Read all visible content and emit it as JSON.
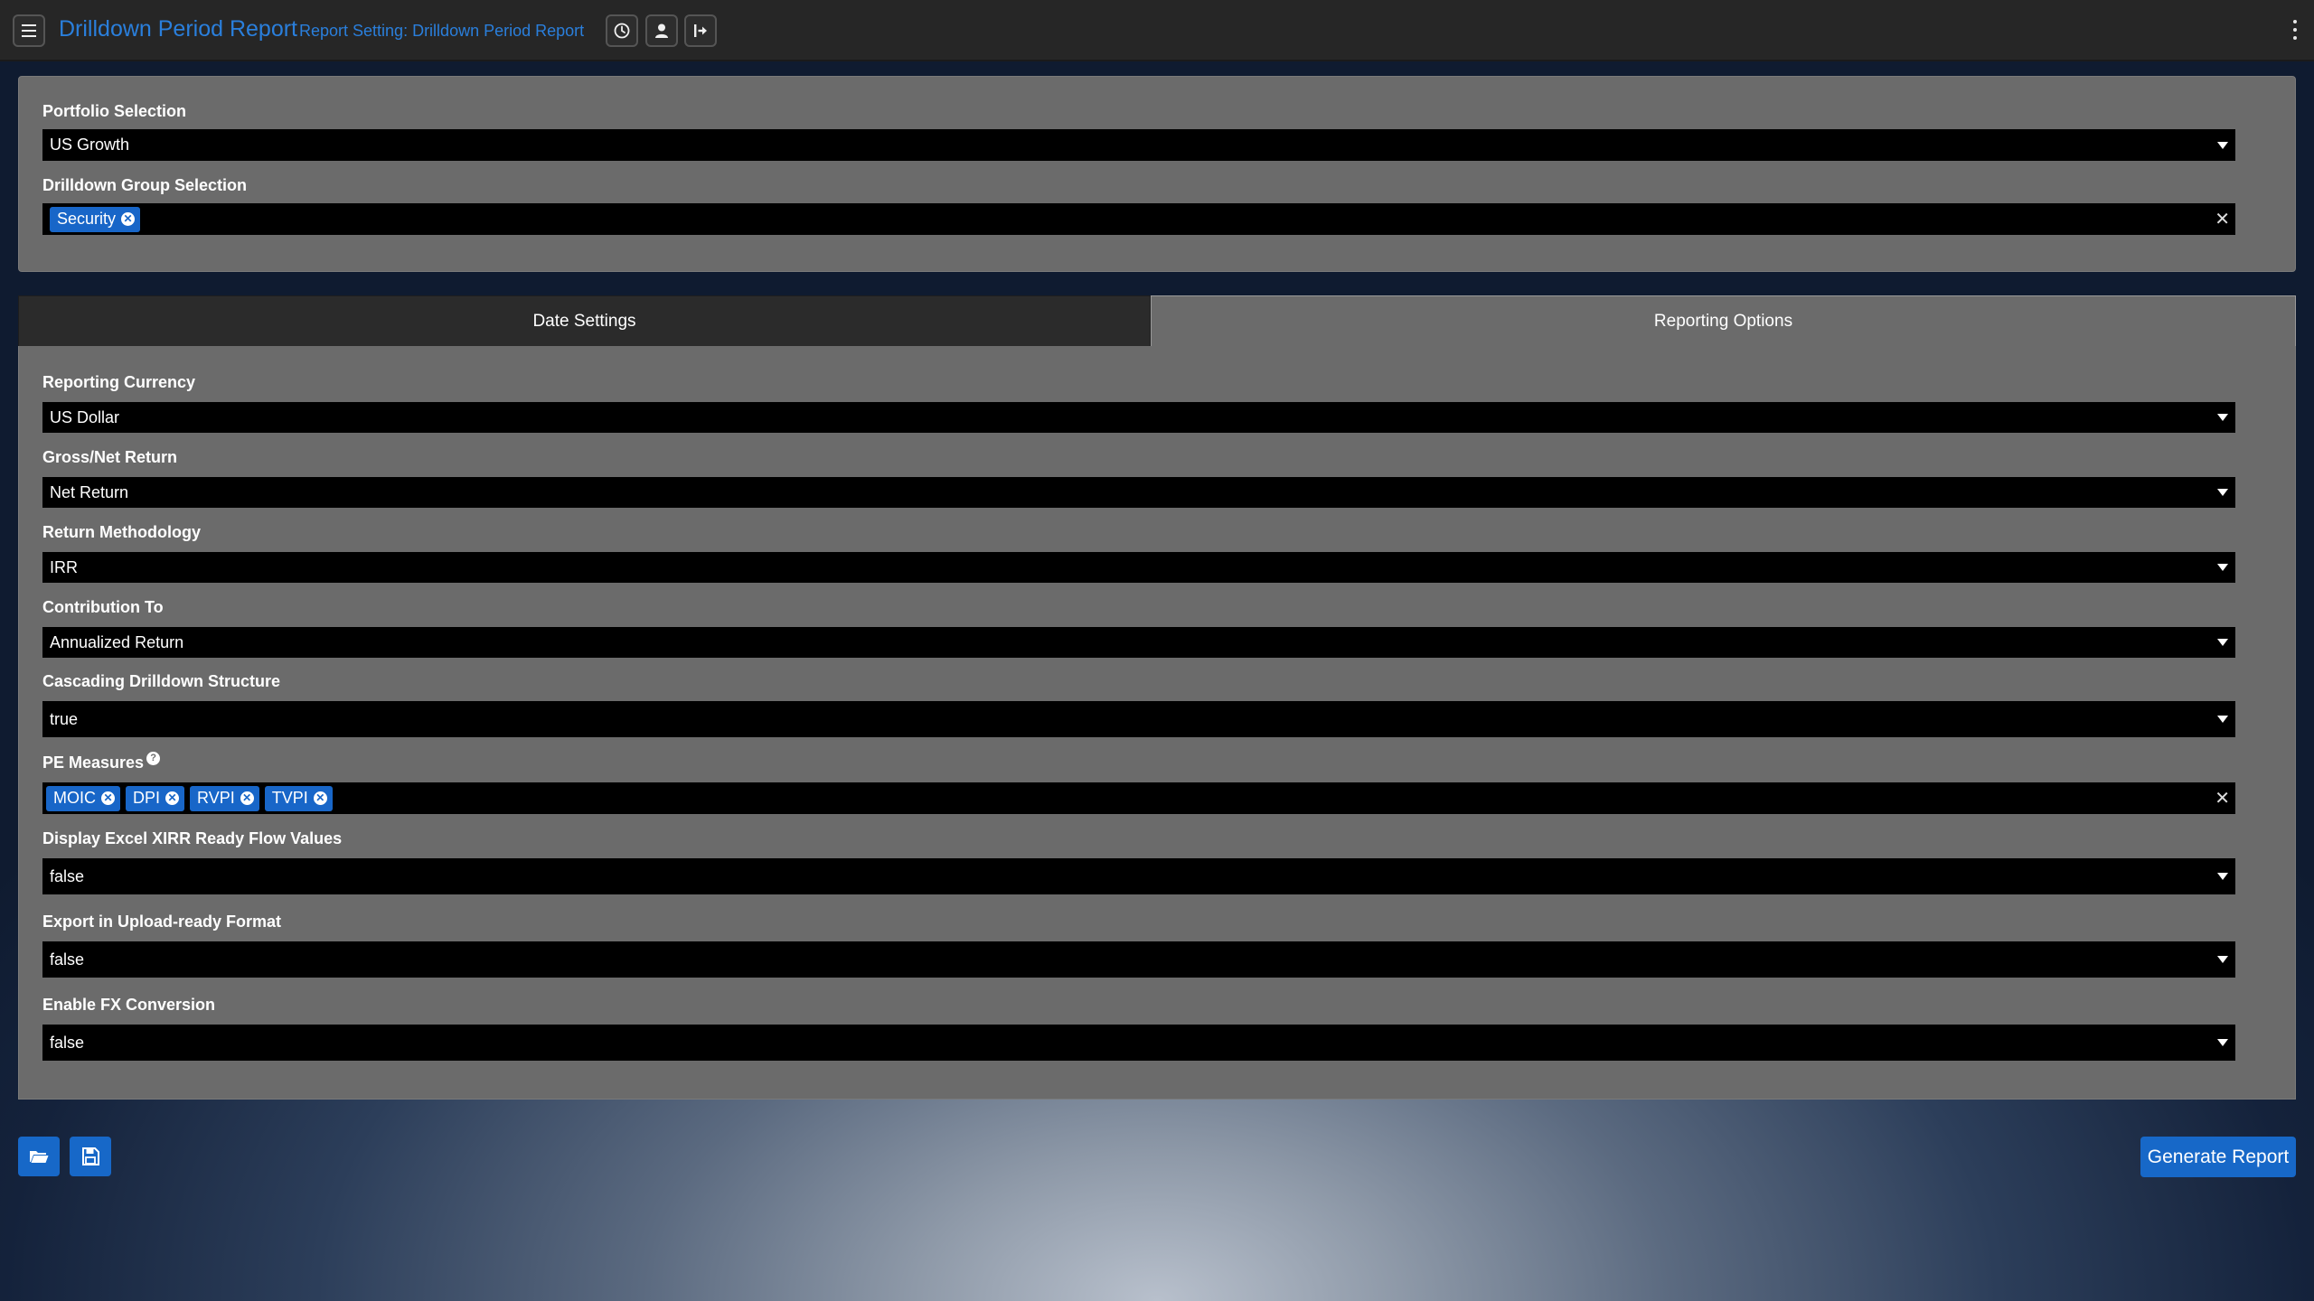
{
  "header": {
    "title": "Drilldown Period Report",
    "report_setting": "Report Setting: Drilldown Period Report",
    "icons": [
      "menu-icon",
      "clock-icon",
      "user-icon",
      "logout-icon",
      "more-vertical-icon"
    ]
  },
  "selection": {
    "portfolio_label": "Portfolio Selection",
    "portfolio_value": "US Growth",
    "drilldown_group_label": "Drilldown Group Selection",
    "drilldown_group_chips": [
      "Security"
    ]
  },
  "tabs": {
    "date_settings": "Date Settings",
    "reporting_options": "Reporting Options"
  },
  "options": {
    "reporting_currency": {
      "label": "Reporting Currency",
      "value": "US Dollar"
    },
    "gross_net_return": {
      "label": "Gross/Net Return",
      "value": "Net Return"
    },
    "return_methodology": {
      "label": "Return Methodology",
      "value": "IRR"
    },
    "contribution_to": {
      "label": "Contribution To",
      "value": "Annualized Return"
    },
    "cascading_structure": {
      "label": "Cascading Drilldown Structure",
      "value": "true"
    },
    "pe_measures": {
      "label": "PE Measures",
      "chips": [
        "MOIC",
        "DPI",
        "RVPI",
        "TVPI"
      ]
    },
    "excel_xirr": {
      "label": "Display Excel XIRR Ready Flow Values",
      "value": "false"
    },
    "upload_ready": {
      "label": "Export in Upload-ready Format",
      "value": "false"
    },
    "fx_conversion": {
      "label": "Enable FX Conversion",
      "value": "false"
    }
  },
  "footer": {
    "open_icon": "folder-open-icon",
    "save_icon": "save-icon",
    "generate_label": "Generate Report"
  },
  "colors": {
    "accent": "#1768c8",
    "title_blue": "#2a7fdc",
    "panel": "#6b6b6b",
    "input": "#000000"
  }
}
